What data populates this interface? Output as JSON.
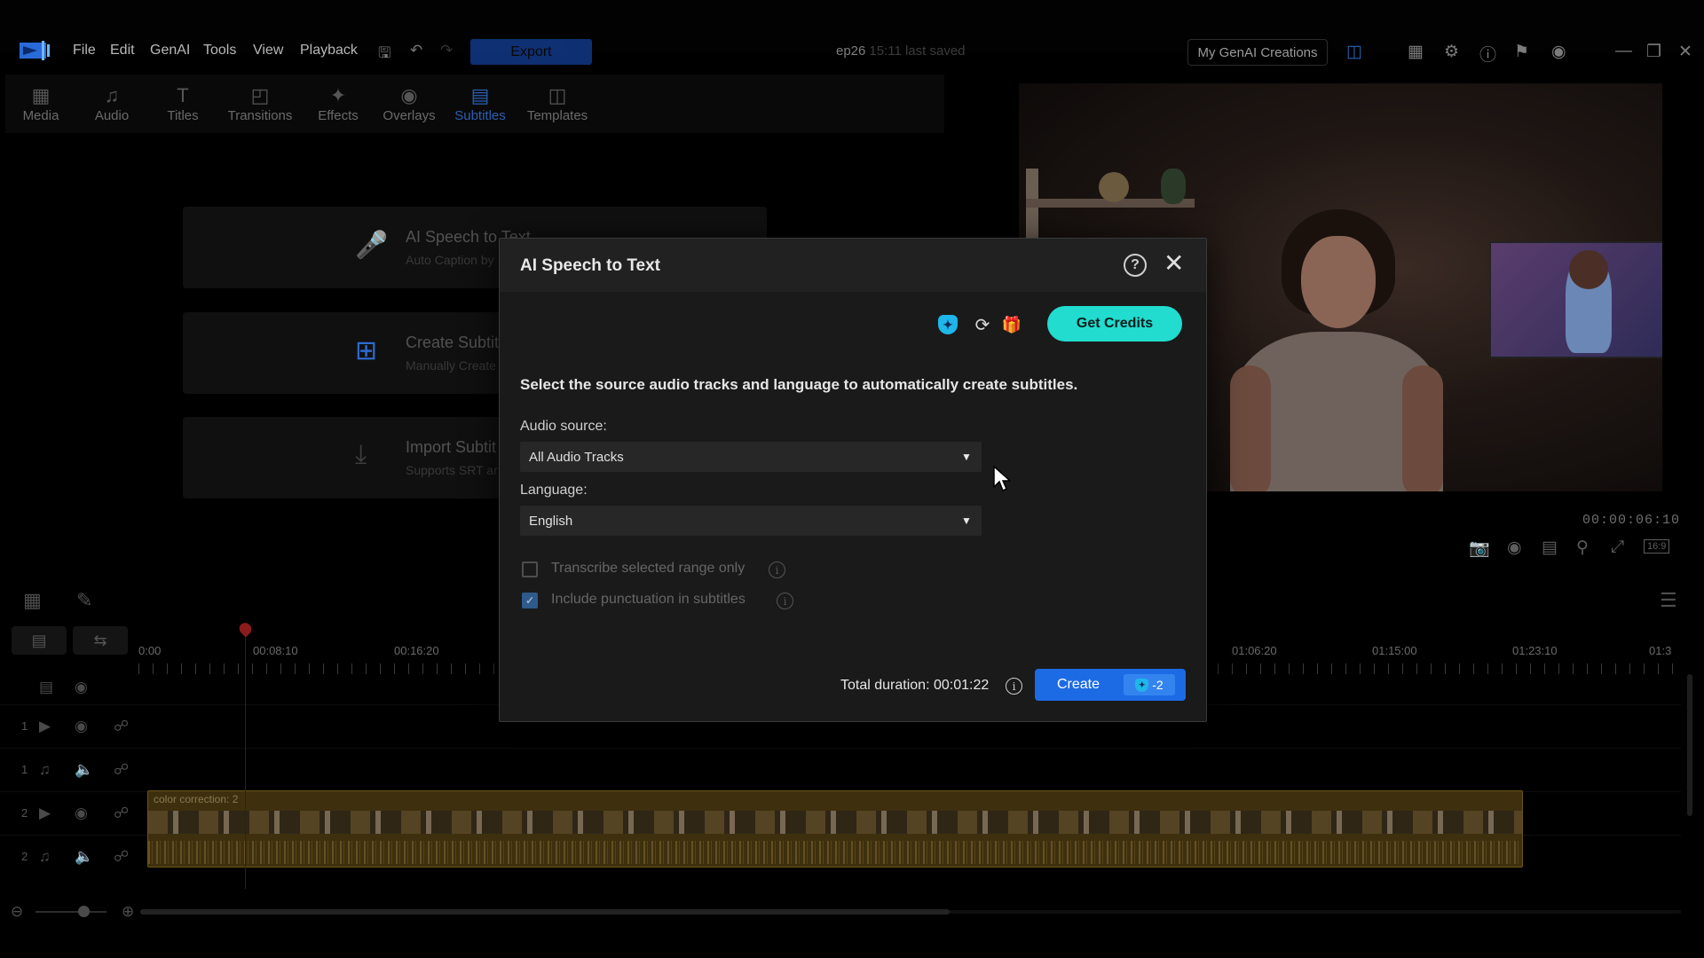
{
  "menubar": {
    "items": [
      "File",
      "Edit",
      "GenAI",
      "Tools",
      "View",
      "Playback"
    ],
    "export_label": "Export",
    "project_name": "ep26",
    "project_saved": "15:11 last saved",
    "genai_label": "My GenAI Creations"
  },
  "rooms": {
    "tabs": [
      {
        "label": "Media",
        "icon": "media-icon"
      },
      {
        "label": "Audio",
        "icon": "audio-icon"
      },
      {
        "label": "Titles",
        "icon": "titles-icon"
      },
      {
        "label": "Transitions",
        "icon": "transitions-icon"
      },
      {
        "label": "Effects",
        "icon": "effects-icon"
      },
      {
        "label": "Overlays",
        "icon": "overlays-icon"
      },
      {
        "label": "Subtitles",
        "icon": "subtitles-icon"
      },
      {
        "label": "Templates",
        "icon": "templates-icon"
      }
    ],
    "active": "Subtitles",
    "active_color": "#2c5fb3"
  },
  "subtitle_panel": {
    "cards": [
      {
        "title": "AI Speech to Text",
        "subtitle": "Auto Caption by"
      },
      {
        "title": "Create Subtitl",
        "subtitle": "Manually Create"
      },
      {
        "title": "Import Subtit",
        "subtitle": "Supports SRT ar"
      }
    ]
  },
  "preview": {
    "timecode": "00:00:06:10",
    "aspect_ratio": "16:9"
  },
  "timeline": {
    "ruler_labels": [
      "0:00",
      "00:08:10",
      "00:16:20",
      "01:06:20",
      "01:15:00",
      "01:23:10",
      "01:3"
    ],
    "track_numbers": [
      "1",
      "1",
      "2",
      "2"
    ],
    "clip_label": "color correction: 2"
  },
  "dialog": {
    "title": "AI Speech to Text",
    "get_credits_label": "Get Credits",
    "description": "Select the source audio tracks and language to automatically create subtitles.",
    "audio_source_label": "Audio source:",
    "audio_source_value": "All Audio Tracks",
    "language_label": "Language:",
    "language_value": "English",
    "options": [
      {
        "label": "Transcribe selected range only",
        "checked": false
      },
      {
        "label": "Include punctuation in subtitles",
        "checked": true
      }
    ],
    "total_duration": "Total duration: 00:01:22",
    "create_label": "Create",
    "create_cost": "-2",
    "accent_color": "#1d6be4",
    "credits_color": "#21dccf"
  }
}
